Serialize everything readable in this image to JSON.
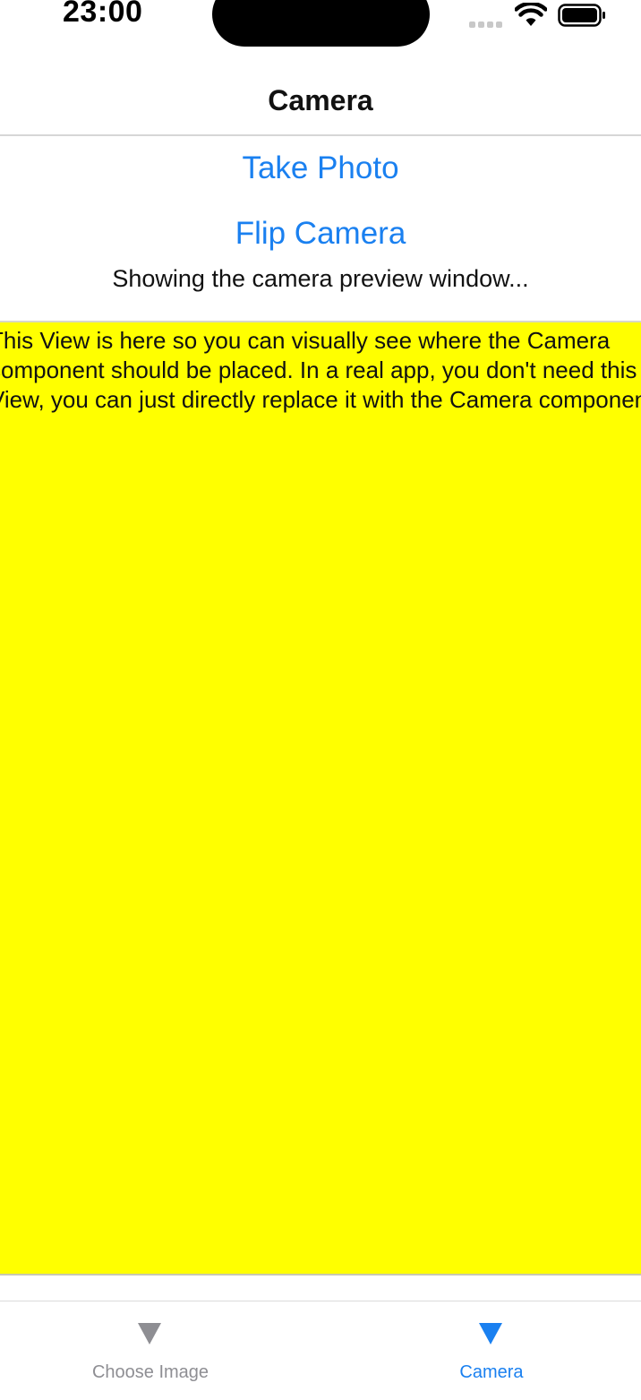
{
  "status_bar": {
    "time": "23:00",
    "icons": [
      "cellular-signal-icon",
      "wifi-icon",
      "battery-icon"
    ]
  },
  "nav": {
    "title": "Camera"
  },
  "controls": {
    "take_photo_label": "Take Photo",
    "flip_camera_label": "Flip Camera",
    "status_message": "Showing the camera preview window..."
  },
  "preview": {
    "text": "This View is here so you can visually see where the Camera component should be placed. In a real app, you don't need this View, you can just directly replace it with the Camera component.",
    "background_color": "#ffff00"
  },
  "tab_bar": {
    "tabs": [
      {
        "label": "Choose Image",
        "icon": "triangle-down-icon",
        "selected": false
      },
      {
        "label": "Camera",
        "icon": "triangle-down-icon",
        "selected": true
      }
    ],
    "active_color": "#1a80f0",
    "inactive_color": "#8e8e93"
  }
}
